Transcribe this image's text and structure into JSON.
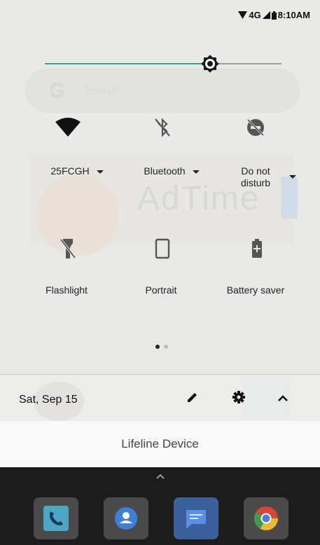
{
  "status_bar": {
    "network": "4G",
    "time": "8:10AM"
  },
  "quick_settings": {
    "tiles": [
      {
        "label": "25FCGH",
        "icon": "wifi-icon",
        "dropdown": true
      },
      {
        "label": "Bluetooth",
        "icon": "bluetooth-disabled-icon",
        "dropdown": true
      },
      {
        "label_line1": "Do not",
        "label_line2": "disturb",
        "icon": "do-not-disturb-off-icon",
        "dropdown": true
      },
      {
        "label": "Flashlight",
        "icon": "flashlight-off-icon"
      },
      {
        "label": "Portrait",
        "icon": "portrait-icon"
      },
      {
        "label": "Battery saver",
        "icon": "battery-saver-icon"
      }
    ],
    "page_dots": 2,
    "active_page": 0
  },
  "footer": {
    "date": "Sat, Sep 15"
  },
  "device_name": "Lifeline Device",
  "background": {
    "search_text": "Search",
    "ad_text": "AdTime"
  },
  "colors": {
    "accent": "#3f9a8c",
    "panel_bg": "#e9e9e7"
  }
}
